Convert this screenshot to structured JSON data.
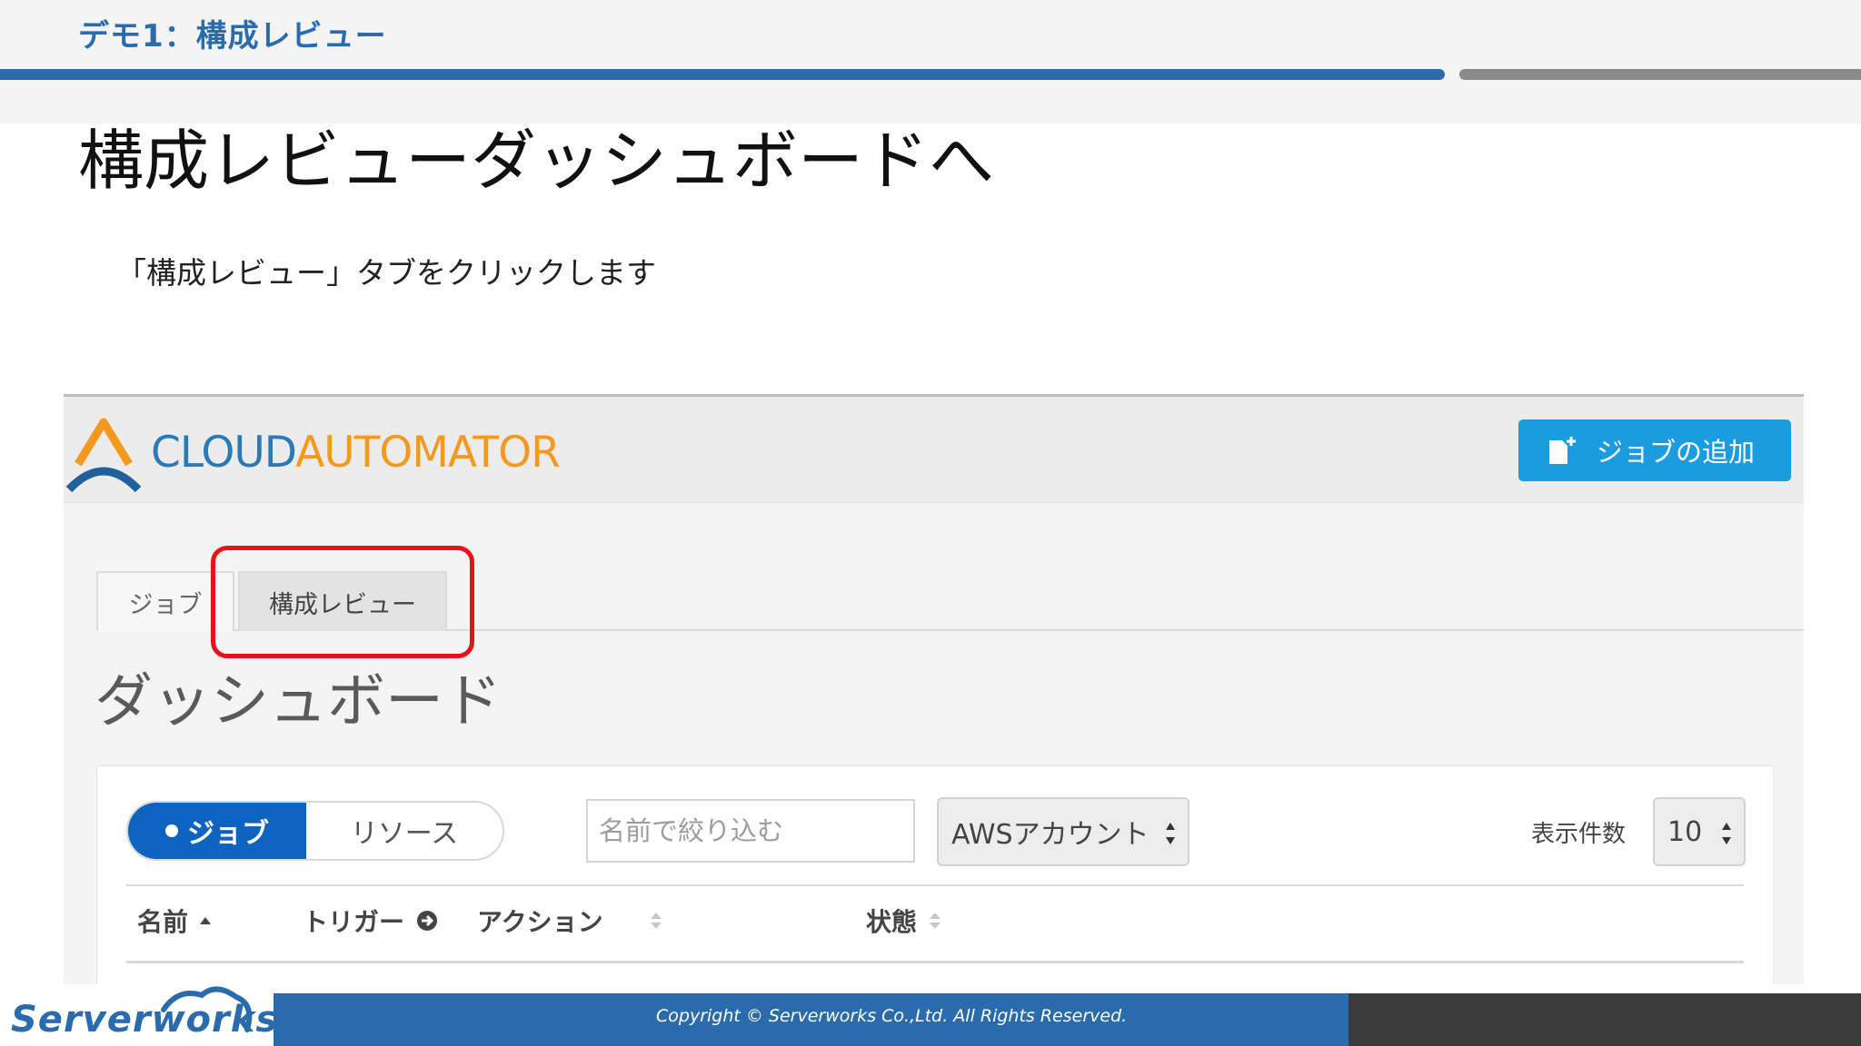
{
  "slide": {
    "section_title": "デモ1：構成レビュー",
    "title": "構成レビューダッシュボードへ",
    "instruction": "「構成レビュー」タブをクリックします"
  },
  "app": {
    "logo": {
      "part1": "CLOUD",
      "part2": "AUTOMATOR"
    },
    "add_job_label": "ジョブの追加",
    "tabs": [
      {
        "label": "ジョブ",
        "active": false
      },
      {
        "label": "構成レビュー",
        "active": true
      }
    ],
    "dashboard_title": "ダッシュボード",
    "segment": {
      "jobs": "ジョブ",
      "resources": "リソース",
      "selected": "ジョブ"
    },
    "filter_placeholder": "名前で絞り込む",
    "aws_account_select": "AWSアカウント",
    "count_label": "表示件数",
    "count_value": "10",
    "table_headers": {
      "name": "名前",
      "trigger": "トリガー",
      "action": "アクション",
      "status": "状態"
    }
  },
  "footer": {
    "brand": "Serverworks",
    "copyright": "Copyright ©  Serverworks Co.,Ltd. All Rights Reserved."
  },
  "colors": {
    "brand_blue": "#2a6bad",
    "button_blue": "#1b9be0",
    "segment_blue": "#0c64c0",
    "highlight_red": "#e8121b",
    "logo_orange": "#f39a1e"
  }
}
